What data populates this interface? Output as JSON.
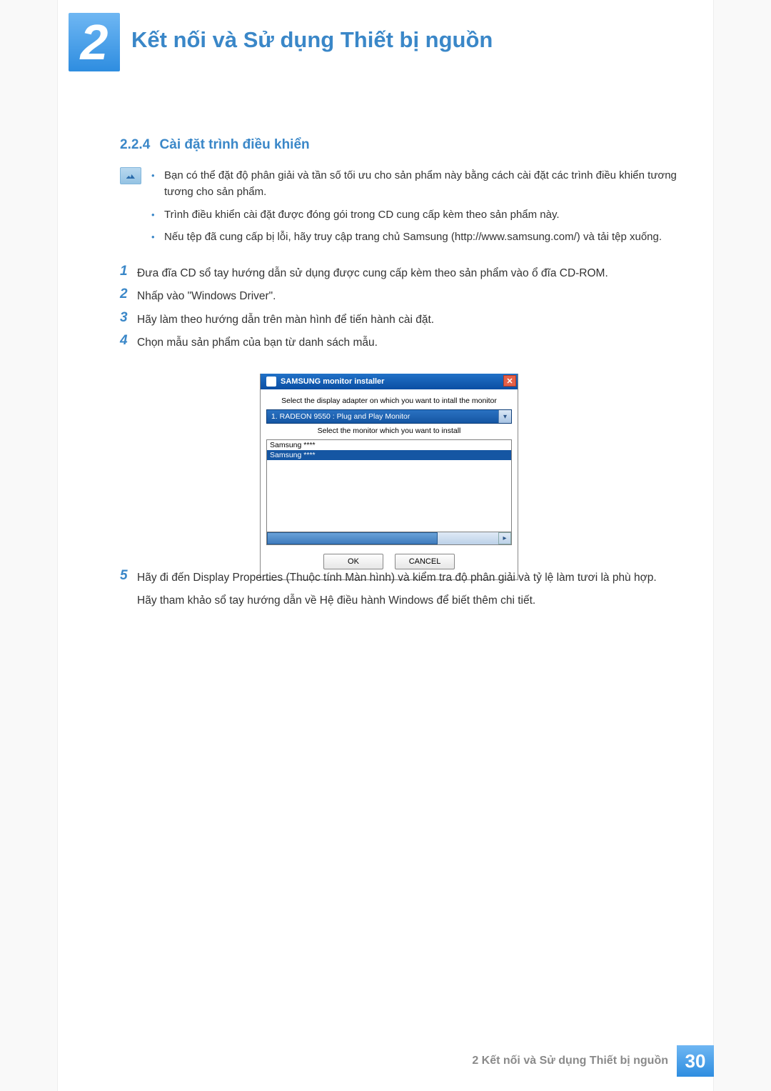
{
  "chapter": {
    "number": "2",
    "title": "Kết nối và Sử dụng Thiết bị nguồn"
  },
  "section": {
    "number": "2.2.4",
    "title": "Cài đặt trình điều khiển"
  },
  "notes": [
    "Bạn có thể đặt độ phân giải và tần số tối ưu cho sản phẩm này bằng cách cài đặt các trình điều khiển tương tương cho sản phẩm.",
    "Trình điều khiển cài đặt được đóng gói trong CD cung cấp kèm theo sản phẩm này.",
    "Nếu tệp đã cung cấp bị lỗi, hãy truy cập trang chủ Samsung (http://www.samsung.com/) và tải tệp xuống."
  ],
  "steps": [
    {
      "num": "1",
      "text": "Đưa đĩa CD sổ tay hướng dẫn sử dụng được cung cấp kèm theo sản phẩm vào ổ đĩa CD-ROM."
    },
    {
      "num": "2",
      "text": "Nhấp vào \"Windows Driver\"."
    },
    {
      "num": "3",
      "text": "Hãy làm theo hướng dẫn trên màn hình để tiến hành cài đặt."
    },
    {
      "num": "4",
      "text": "Chọn mẫu sản phẩm của bạn từ danh sách mẫu."
    }
  ],
  "dialog": {
    "title": "SAMSUNG monitor installer",
    "prompt1": "Select the display adapter on which you want to intall the monitor",
    "adapter": "1. RADEON 9550 : Plug and Play Monitor",
    "prompt2": "Select the monitor which you want to install",
    "list": [
      "Samsung ****",
      "Samsung ****"
    ],
    "ok": "OK",
    "cancel": "CANCEL"
  },
  "post_steps": {
    "num": "5",
    "text": "Hãy đi đến Display Properties (Thuộc tính Màn hình) và kiểm tra độ phân giải và tỷ lệ làm tươi là phù hợp.",
    "after": "Hãy tham khảo sổ tay hướng dẫn về Hệ điều hành Windows để biết thêm chi tiết."
  },
  "footer": {
    "text": "2 Kết nối và Sử dụng Thiết bị nguồn",
    "page": "30"
  }
}
